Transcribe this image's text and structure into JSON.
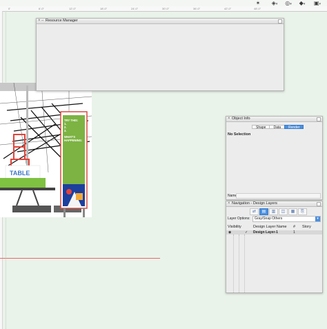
{
  "toolbar": {
    "icons": [
      "magic-wand-icon",
      "snap-icon",
      "view-icon",
      "render-icon",
      "display-icon"
    ]
  },
  "ruler": {
    "ticks": [
      "0'",
      "6'-0\"",
      "12'-0\"",
      "18'-0\"",
      "24'-0\"",
      "30'-0\"",
      "36'-0\"",
      "42'-0\"",
      "48'-0\""
    ]
  },
  "resource_manager": {
    "title": "Resource Manager"
  },
  "design_image": {
    "table_title": "DRAW TABLE",
    "try_this": "TRY THIS:",
    "steps": [
      "1.",
      "2.",
      "3."
    ],
    "whats_happening": "WHAT'S HAPPENING:"
  },
  "object_info": {
    "title": "Object Info",
    "tabs": [
      "Shape",
      "Data",
      "Render"
    ],
    "active_tab": "Render",
    "selection_text": "No Selection",
    "name_label": "Name:"
  },
  "navigation": {
    "title": "Navigation - Design Layers",
    "layer_options_label": "Layer Options:",
    "layer_options_value": "Gray/Snap Others",
    "columns": {
      "visibility": "Visibility",
      "name": "Design Layer Name",
      "number": "#",
      "story": "Story"
    },
    "rows": [
      {
        "check": "✓",
        "name": "Design Layer-1",
        "number": "1",
        "story": ""
      }
    ]
  }
}
